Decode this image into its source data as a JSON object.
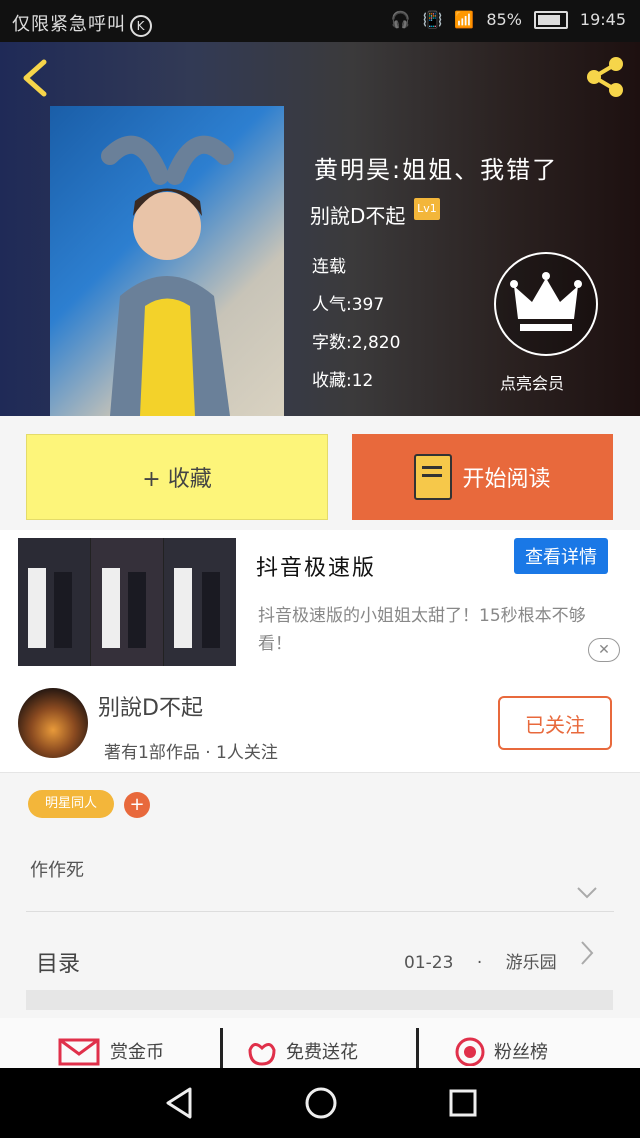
{
  "status_bar": {
    "left_text": "仅限紧急呼叫",
    "right_battery": "85%",
    "time": "19:45"
  },
  "book": {
    "title": "黄明昊:姐姐、我错了",
    "author": "别說D不起",
    "level": "Lv1",
    "status": "连载",
    "popularity": "人气:397",
    "word_count": "字数:2,820",
    "favorites": "收藏:12",
    "vip_label": "点亮会员"
  },
  "actions": {
    "favorite_label": "+ 收藏",
    "read_label": "开始阅读"
  },
  "ad": {
    "title": "抖音极速版",
    "button": "查看详情",
    "description": "抖音极速版的小姐姐太甜了！15秒根本不够看！",
    "close": "✕"
  },
  "author_section": {
    "name": "别說D不起",
    "stats": "著有1部作品 · 1人关注",
    "follow_button": "已关注"
  },
  "tags": {
    "tag1": "明星同人",
    "add": "+"
  },
  "intro": "作作死",
  "catalog": {
    "label": "目录",
    "date": "01-23",
    "sep": "·",
    "publisher": "游乐园"
  },
  "bottom_actions": [
    {
      "label": "赏金币"
    },
    {
      "label": "免费送花"
    },
    {
      "label": "粉丝榜"
    }
  ],
  "colors": {
    "accent_orange": "#e8693c",
    "yellow": "#fdf57a",
    "blue": "#1a78e6",
    "gold": "#f3b63a"
  }
}
